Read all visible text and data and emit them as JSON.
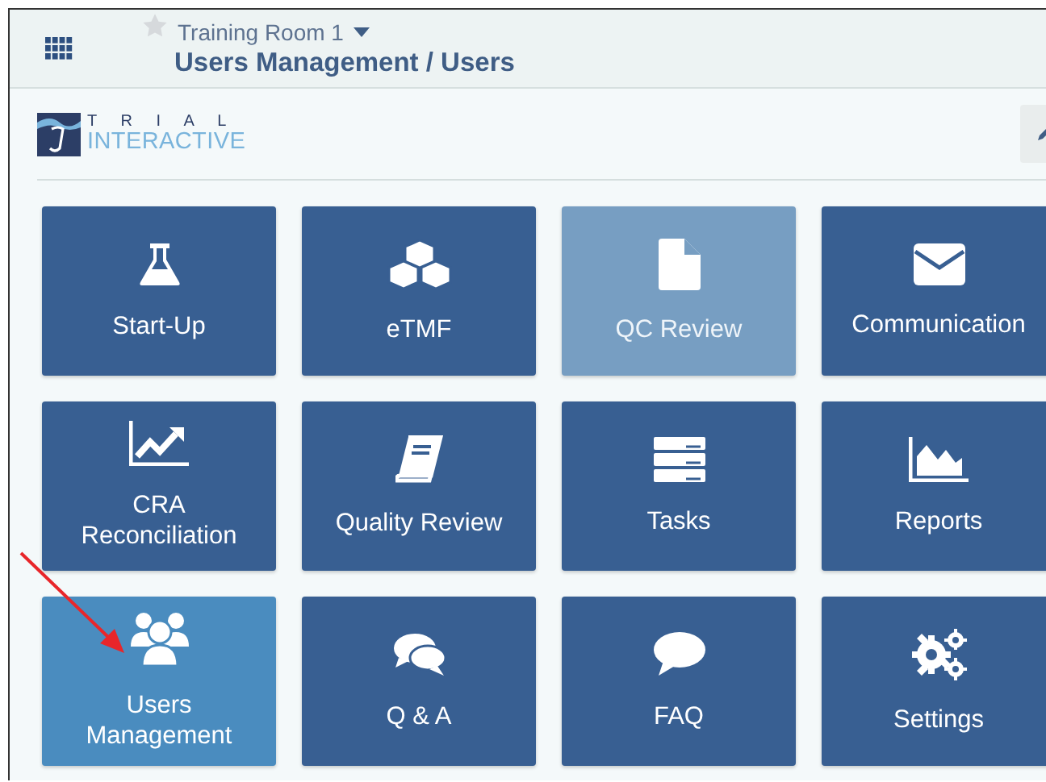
{
  "header": {
    "room": "Training Room 1",
    "favorite": false,
    "breadcrumb": "Users Management / Users"
  },
  "logo": {
    "top": "T R I A L",
    "bottom": "INTERACTIVE"
  },
  "tiles": [
    {
      "label": "Start-Up",
      "selected": false,
      "disabled": false
    },
    {
      "label": "eTMF",
      "selected": false,
      "disabled": false
    },
    {
      "label": "QC Review",
      "selected": false,
      "disabled": true
    },
    {
      "label": "Communication",
      "selected": false,
      "disabled": false
    },
    {
      "label": "CRA Reconciliation",
      "selected": false,
      "disabled": false
    },
    {
      "label": "Quality Review",
      "selected": false,
      "disabled": false
    },
    {
      "label": "Tasks",
      "selected": false,
      "disabled": false
    },
    {
      "label": "Reports",
      "selected": false,
      "disabled": false
    },
    {
      "label": "Users Management",
      "selected": true,
      "disabled": false
    },
    {
      "label": "Q & A",
      "selected": false,
      "disabled": false
    },
    {
      "label": "FAQ",
      "selected": false,
      "disabled": false
    },
    {
      "label": "Settings",
      "selected": false,
      "disabled": false
    }
  ]
}
